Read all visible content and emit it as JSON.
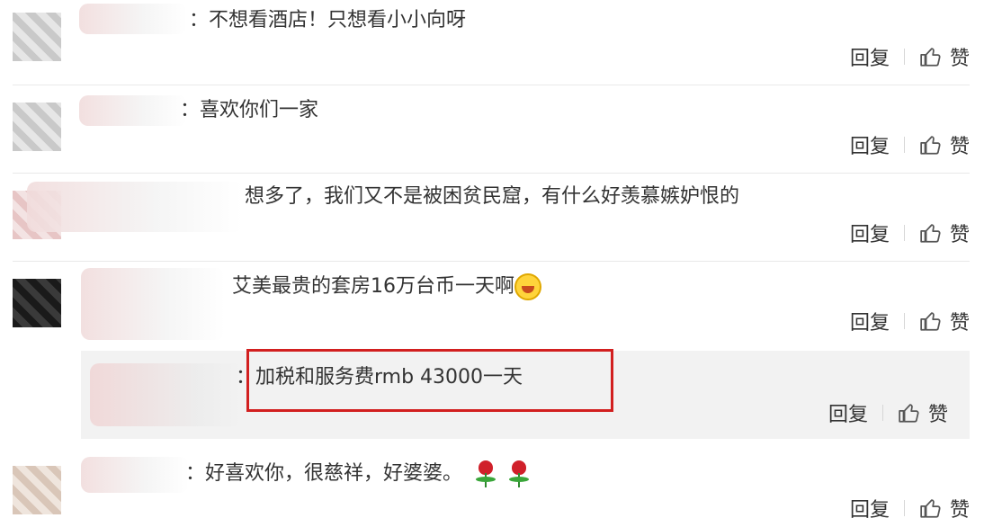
{
  "comments": [
    {
      "text": "：不想看酒店！只想看小小向呀",
      "reply": "回复",
      "like": "赞"
    },
    {
      "text": "：喜欢你们一家",
      "reply": "回复",
      "like": "赞"
    },
    {
      "text": "想多了，我们又不是被困贫民窟，有什么好羡慕嫉妒恨的",
      "reply": "回复",
      "like": "赞"
    },
    {
      "text": "艾美最贵的套房16万台币一天啊",
      "reply": "回复",
      "like": "赞"
    }
  ],
  "reply_comment": {
    "text": "：加税和服务费rmb 43000一天",
    "reply": "回复",
    "like": "赞"
  },
  "last_comment": {
    "text": "：好喜欢你，很慈祥，好婆婆。",
    "reply": "回复",
    "like": "赞"
  },
  "colors": {
    "highlight_frame": "#d21f1f",
    "reply_bg": "#f2f2f2"
  },
  "icons": [
    "thumbs-up-icon",
    "laughing-emoji-icon",
    "rose-icon"
  ]
}
